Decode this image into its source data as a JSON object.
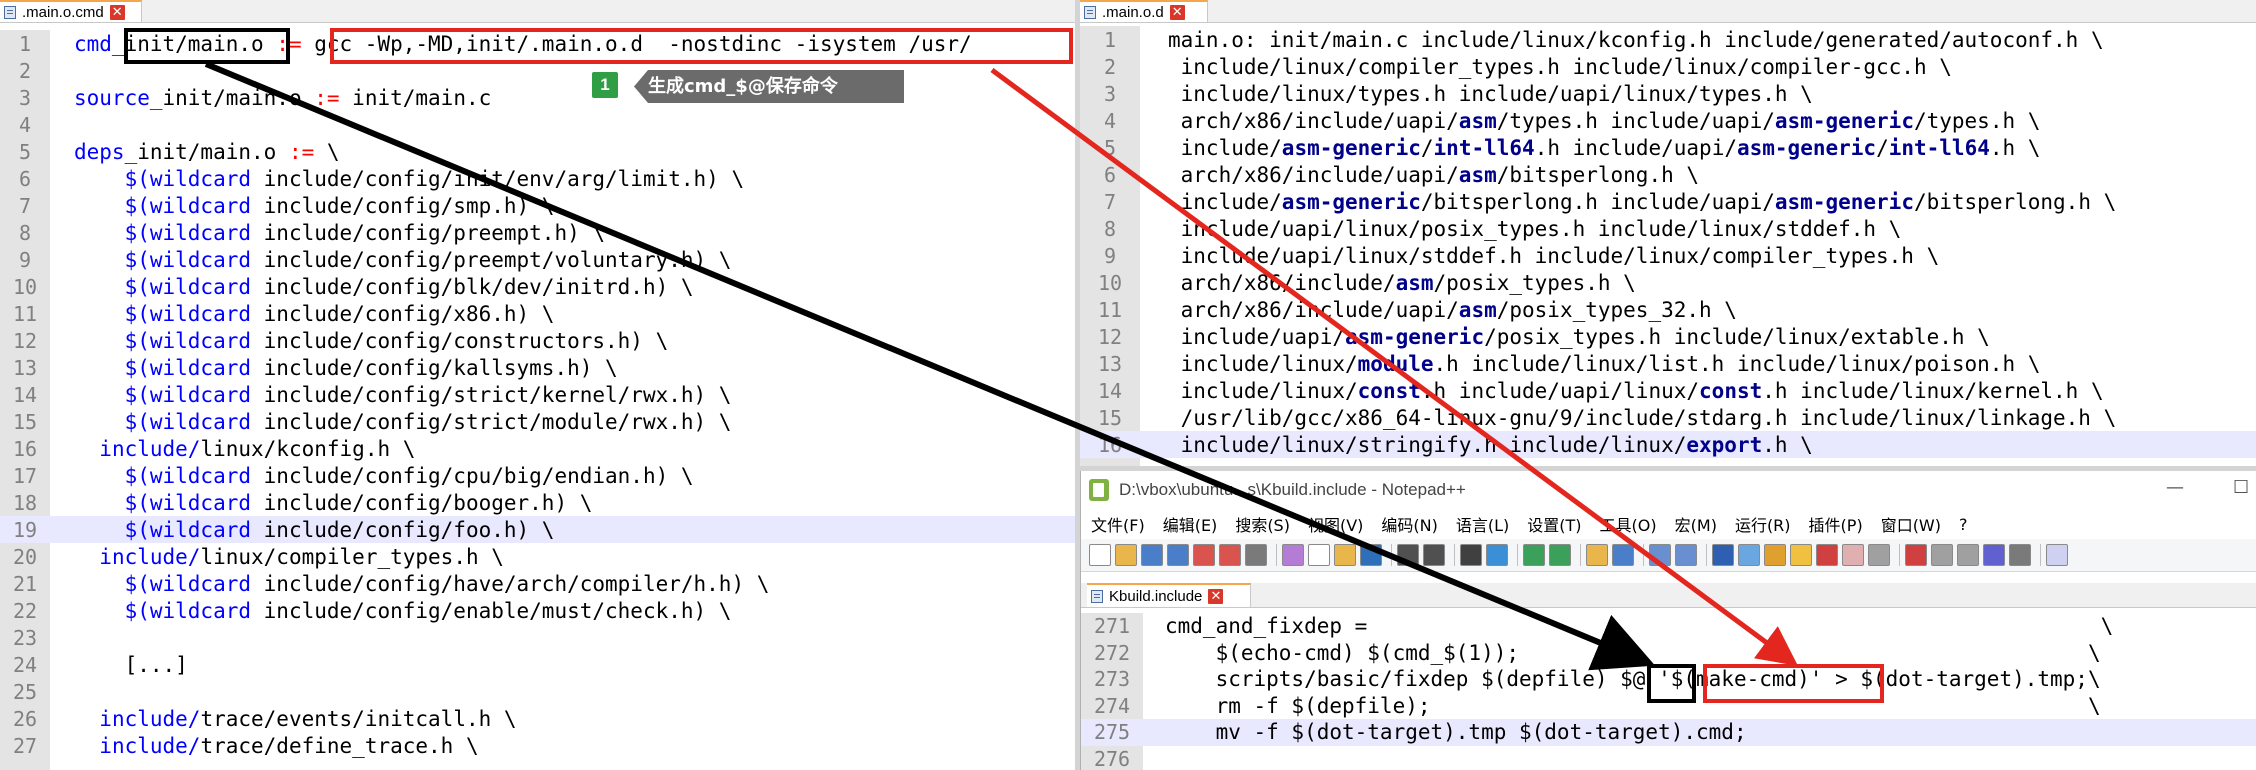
{
  "left_pane": {
    "tab_label": ".main.o.cmd",
    "lines": [
      {
        "n": "1",
        "t": "cmd_init/main.o := gcc -Wp,-MD,init/.main.o.d  -nostdinc -isystem /usr/"
      },
      {
        "n": "2",
        "t": ""
      },
      {
        "n": "3",
        "t": "source_init/main.o := init/main.c"
      },
      {
        "n": "4",
        "t": ""
      },
      {
        "n": "5",
        "t": "deps_init/main.o := \\"
      },
      {
        "n": "6",
        "t": "    $(wildcard include/config/init/env/arg/limit.h) \\"
      },
      {
        "n": "7",
        "t": "    $(wildcard include/config/smp.h) \\"
      },
      {
        "n": "8",
        "t": "    $(wildcard include/config/preempt.h) \\"
      },
      {
        "n": "9",
        "t": "    $(wildcard include/config/preempt/voluntary.h) \\"
      },
      {
        "n": "10",
        "t": "    $(wildcard include/config/blk/dev/initrd.h) \\"
      },
      {
        "n": "11",
        "t": "    $(wildcard include/config/x86.h) \\"
      },
      {
        "n": "12",
        "t": "    $(wildcard include/config/constructors.h) \\"
      },
      {
        "n": "13",
        "t": "    $(wildcard include/config/kallsyms.h) \\"
      },
      {
        "n": "14",
        "t": "    $(wildcard include/config/strict/kernel/rwx.h) \\"
      },
      {
        "n": "15",
        "t": "    $(wildcard include/config/strict/module/rwx.h) \\"
      },
      {
        "n": "16",
        "t": "  include/linux/kconfig.h \\"
      },
      {
        "n": "17",
        "t": "    $(wildcard include/config/cpu/big/endian.h) \\"
      },
      {
        "n": "18",
        "t": "    $(wildcard include/config/booger.h) \\"
      },
      {
        "n": "19",
        "t": "    $(wildcard include/config/foo.h) \\"
      },
      {
        "n": "20",
        "t": "  include/linux/compiler_types.h \\"
      },
      {
        "n": "21",
        "t": "    $(wildcard include/config/have/arch/compiler/h.h) \\"
      },
      {
        "n": "22",
        "t": "    $(wildcard include/config/enable/must/check.h) \\"
      },
      {
        "n": "23",
        "t": ""
      },
      {
        "n": "24",
        "t": "    [...]"
      },
      {
        "n": "25",
        "t": ""
      },
      {
        "n": "26",
        "t": "  include/trace/events/initcall.h \\"
      },
      {
        "n": "27",
        "t": "  include/trace/define_trace.h \\"
      }
    ]
  },
  "annotation": {
    "badge": "1",
    "callout": "生成cmd_$@保存命令"
  },
  "right_top_pane": {
    "tab_label": ".main.o.d",
    "lines": [
      {
        "n": "1",
        "t": "main.o: init/main.c include/linux/kconfig.h include/generated/autoconf.h \\"
      },
      {
        "n": "2",
        "t": " include/linux/compiler_types.h include/linux/compiler-gcc.h \\"
      },
      {
        "n": "3",
        "t": " include/linux/types.h include/uapi/linux/types.h \\"
      },
      {
        "n": "4",
        "t": " arch/x86/include/uapi/asm/types.h include/uapi/asm-generic/types.h \\"
      },
      {
        "n": "5",
        "t": " include/asm-generic/int-ll64.h include/uapi/asm-generic/int-ll64.h \\"
      },
      {
        "n": "6",
        "t": " arch/x86/include/uapi/asm/bitsperlong.h \\"
      },
      {
        "n": "7",
        "t": " include/asm-generic/bitsperlong.h include/uapi/asm-generic/bitsperlong.h \\"
      },
      {
        "n": "8",
        "t": " include/uapi/linux/posix_types.h include/linux/stddef.h \\"
      },
      {
        "n": "9",
        "t": " include/uapi/linux/stddef.h include/linux/compiler_types.h \\"
      },
      {
        "n": "10",
        "t": " arch/x86/include/asm/posix_types.h \\"
      },
      {
        "n": "11",
        "t": " arch/x86/include/uapi/asm/posix_types_32.h \\"
      },
      {
        "n": "12",
        "t": " include/uapi/asm-generic/posix_types.h include/linux/extable.h \\"
      },
      {
        "n": "13",
        "t": " include/linux/module.h include/linux/list.h include/linux/poison.h \\"
      },
      {
        "n": "14",
        "t": " include/linux/const.h include/uapi/linux/const.h include/linux/kernel.h \\"
      },
      {
        "n": "15",
        "t": " /usr/lib/gcc/x86_64-linux-gnu/9/include/stdarg.h include/linux/linkage.h \\"
      },
      {
        "n": "16",
        "t": " include/linux/stringify.h include/linux/export.h \\"
      }
    ]
  },
  "notepad": {
    "title": "D:\\vbox\\ubuntu...s\\Kbuild.include - Notepad++",
    "minimize": "—",
    "maximize": "☐",
    "menus": [
      "文件(F)",
      "编辑(E)",
      "搜索(S)",
      "视图(V)",
      "编码(N)",
      "语言(L)",
      "设置(T)",
      "工具(O)",
      "宏(M)",
      "运行(R)",
      "插件(P)",
      "窗口(W)",
      "?"
    ],
    "tab_label": "Kbuild.include",
    "lines": [
      {
        "n": "271",
        "t": "cmd_and_fixdep =                                                          \\"
      },
      {
        "n": "272",
        "t": "    $(echo-cmd) $(cmd_$(1));                                             \\"
      },
      {
        "n": "273",
        "t": "    scripts/basic/fixdep $(depfile) $@ '$(make-cmd)' > $(dot-target).tmp;\\"
      },
      {
        "n": "274",
        "t": "    rm -f $(depfile);                                                    \\"
      },
      {
        "n": "275",
        "t": "    mv -f $(dot-target).tmp $(dot-target).cmd;"
      },
      {
        "n": "276",
        "t": ""
      }
    ]
  },
  "colors": {
    "highlight": "#e8e8ff",
    "arrow_black": "#000000",
    "arrow_red": "#e3261e",
    "badge": "#2f9e44",
    "callout": "#6b6b6b"
  }
}
